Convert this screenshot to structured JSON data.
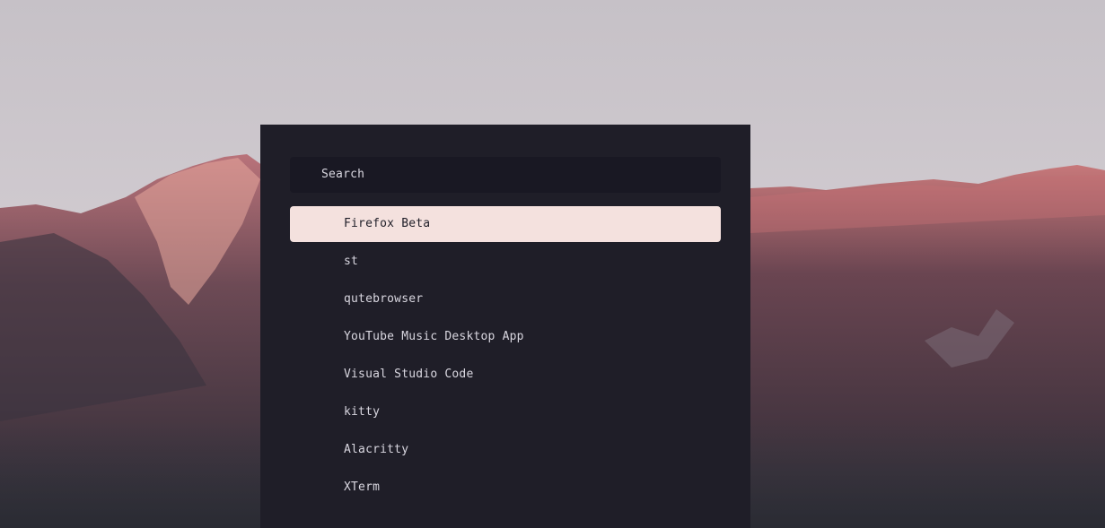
{
  "wallpaper": {
    "icon": "mountain-landscape"
  },
  "launcher": {
    "search": {
      "prompt": "Search",
      "value": "",
      "placeholder": ""
    },
    "items": [
      {
        "label": "Firefox Beta",
        "selected": true
      },
      {
        "label": "st",
        "selected": false
      },
      {
        "label": "qutebrowser",
        "selected": false
      },
      {
        "label": "YouTube Music Desktop App",
        "selected": false
      },
      {
        "label": "Visual Studio Code",
        "selected": false
      },
      {
        "label": "kitty",
        "selected": false
      },
      {
        "label": "Alacritty",
        "selected": false
      },
      {
        "label": "XTerm",
        "selected": false
      }
    ]
  },
  "colors": {
    "window_bg": "#1f1e28",
    "search_bg": "#191823",
    "selected_bg": "#f4e1de",
    "text": "#d9d7e0",
    "selected_text": "#1f1e28"
  }
}
